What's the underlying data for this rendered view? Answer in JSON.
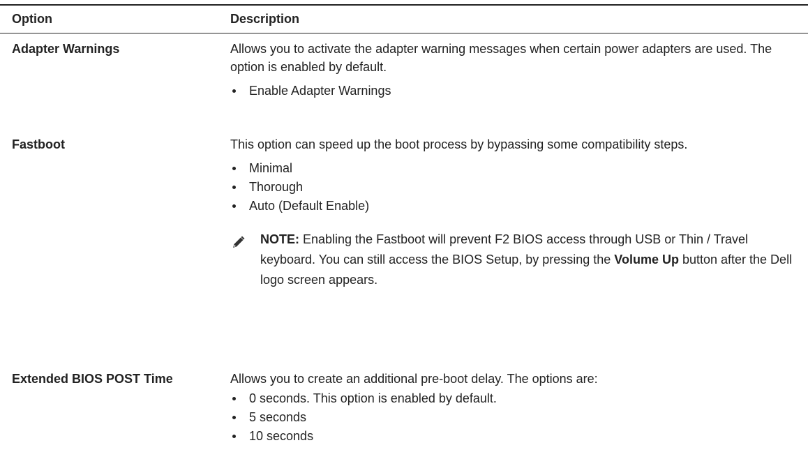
{
  "header": {
    "option": "Option",
    "description": "Description"
  },
  "rows": [
    {
      "option": "Adapter Warnings",
      "description": "Allows you to activate the adapter warning messages when certain power adapters are used. The option is enabled by default.",
      "bullets": [
        "Enable Adapter Warnings"
      ]
    },
    {
      "option": "Fastboot",
      "description": "This option can speed up the boot process by bypassing some compatibility steps.",
      "bullets": [
        "Minimal",
        "Thorough",
        "Auto (Default Enable)"
      ],
      "note": {
        "label": "NOTE:",
        "text_before": " Enabling the Fastboot will prevent F2 BIOS access through USB or Thin / Travel keyboard. You can still access the BIOS Setup, by pressing the ",
        "bold": "Volume Up",
        "text_after": " button after the Dell logo screen appears."
      },
      "note_icon": "pencil-icon"
    },
    {
      "option": "Extended BIOS POST Time",
      "description": "Allows you to create an additional pre-boot delay. The options are:",
      "bullets": [
        "0 seconds. This option is enabled by default.",
        "5 seconds",
        "10 seconds"
      ]
    }
  ]
}
